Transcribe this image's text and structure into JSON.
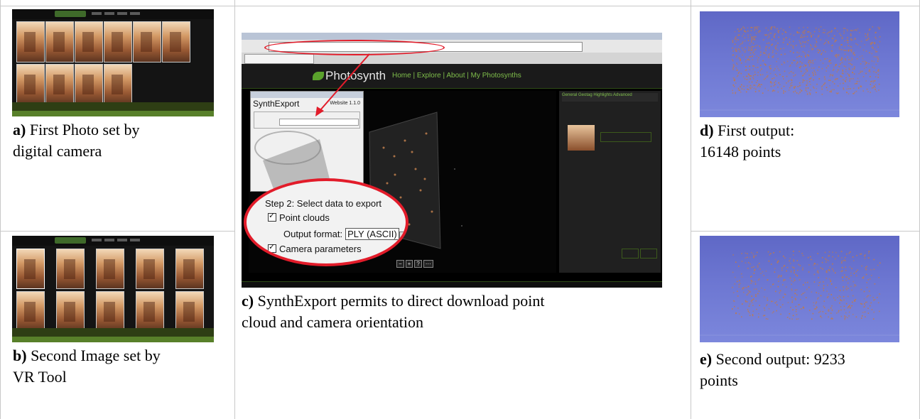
{
  "captions": {
    "a": {
      "label": "a)",
      "text1": " First Photo set by",
      "text2": "digital camera"
    },
    "b": {
      "label": "b)",
      "text1": " Second Image set by",
      "text2": "VR Tool"
    },
    "c": {
      "label": "c)",
      "text1": " SynthExport permits to direct download point",
      "text2": "cloud and camera orientation"
    },
    "d": {
      "label": "d)",
      "text1": " First output:",
      "text2": "16148 points"
    },
    "e": {
      "label": "e)",
      "text1": " Second output: 9233",
      "text2": "points"
    }
  },
  "screenshot": {
    "brand": "Photosynth",
    "nav_links": "Home  |  Explore  |  About  |  My Photosynths",
    "dialog_title": "SynthExport",
    "dialog_version": "Website  1.1.0",
    "zoom_step": "Step 2: Select data to export",
    "zoom_point_clouds": "Point clouds",
    "zoom_output_label": "Output format:",
    "zoom_output_value": "PLY (ASCII)",
    "zoom_camera": "Camera parameters",
    "tools": [
      "−",
      "+",
      "?",
      "⋯"
    ],
    "panel_tabs": "General  Geotag  Highlights  Advanced"
  },
  "colors": {
    "annotation_ring": "#e21c2a",
    "cloud_background": "#6d77d2",
    "point_color": "#c07a4a"
  }
}
